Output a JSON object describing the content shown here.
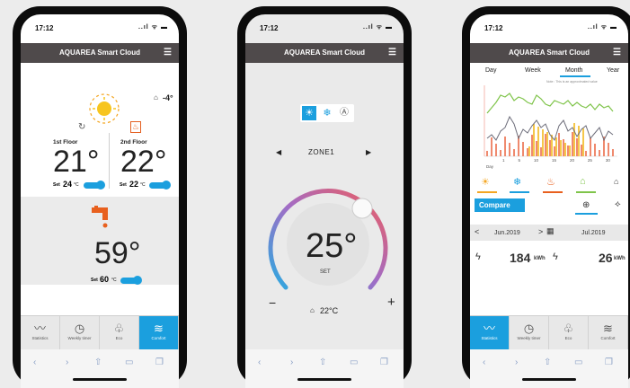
{
  "p1": {
    "time": "17:12",
    "signal": "..ıl ᯤ ▬",
    "title": "AQUAREA Smart Cloud",
    "outdoor": "-4°",
    "zone1": {
      "label": "1st Floor",
      "temp": "21°",
      "set_prefix": "Set",
      "set_value": "24",
      "unit": "°C"
    },
    "zone2": {
      "label": "2nd Floor",
      "temp": "22°",
      "set_prefix": "Set",
      "set_value": "22",
      "unit": "°C"
    },
    "tank": {
      "temp": "59°",
      "set_prefix": "Set",
      "set_value": "60",
      "unit": "°C"
    },
    "nav": [
      {
        "label": "Statistics",
        "icon": "statistics-icon"
      },
      {
        "label": "Weekly timer",
        "icon": "weekly-timer-icon"
      },
      {
        "label": "Eco",
        "icon": "eco-icon"
      },
      {
        "label": "Comfort",
        "icon": "comfort-icon"
      }
    ],
    "accent": "#1b9fde"
  },
  "p2": {
    "time": "17:12",
    "signal": "..ıl ᯤ ▬",
    "title": "AQUAREA Smart Cloud",
    "zone": "ZONE1",
    "set_temp": "25°",
    "set_label": "SET",
    "room_temp": "22°C",
    "minus": "−",
    "plus": "+"
  },
  "p3": {
    "time": "17:12",
    "signal": "..ıl ᯤ ▬",
    "title": "AQUAREA Smart Cloud",
    "tabs": [
      "Day",
      "Week",
      "Month",
      "Year"
    ],
    "active_tab": "Month",
    "note": "Note : This is an approximated value",
    "chart_xlabel": "Day",
    "chart_xticks": [
      "1",
      "5",
      "10",
      "15",
      "20",
      "25",
      "30"
    ],
    "compare_label": "Compare",
    "date1": "Jun.2019",
    "date2": "Jul.2019",
    "value1": "184",
    "value2": "26",
    "unit": "kWh",
    "nav": [
      {
        "label": "Statistics",
        "icon": "statistics-icon"
      },
      {
        "label": "Weekly timer",
        "icon": "weekly-timer-icon"
      },
      {
        "label": "Eco",
        "icon": "eco-icon"
      },
      {
        "label": "Comfort",
        "icon": "comfort-icon"
      }
    ]
  }
}
